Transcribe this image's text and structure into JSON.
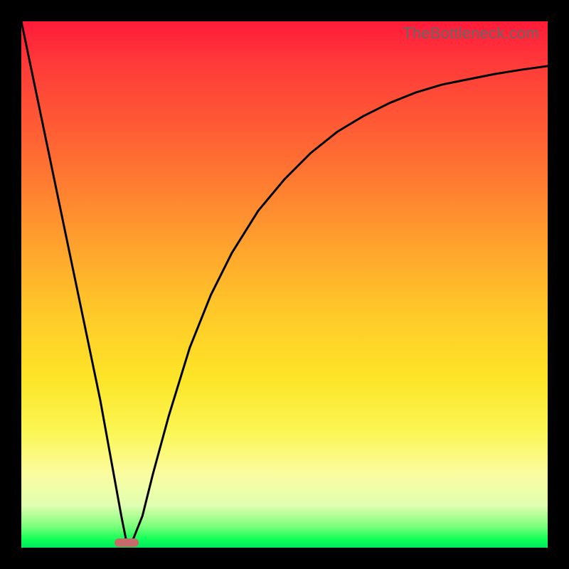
{
  "watermark": "TheBottleneck.com",
  "chart_data": {
    "type": "line",
    "title": "",
    "xlabel": "",
    "ylabel": "",
    "xlim": [
      0,
      100
    ],
    "ylim": [
      0,
      100
    ],
    "grid": false,
    "legend": false,
    "series": [
      {
        "name": "curve",
        "x": [
          0,
          5,
          10,
          15,
          19,
          20,
          21,
          23,
          25,
          28,
          32,
          36,
          40,
          45,
          50,
          55,
          60,
          65,
          70,
          75,
          80,
          85,
          90,
          95,
          100
        ],
        "y": [
          100,
          76,
          52,
          28,
          6,
          1,
          1,
          6,
          14,
          25,
          38,
          48,
          56,
          64,
          70,
          75,
          79,
          82,
          84.5,
          86.5,
          88,
          89,
          90,
          90.8,
          91.5
        ]
      }
    ],
    "marker": {
      "x": 20,
      "y": 1
    },
    "background_gradient": {
      "top": "#ff1a3a",
      "mid_upper": "#ff9a2e",
      "mid": "#fde528",
      "mid_lower": "#fbfca0",
      "bottom": "#00e860"
    }
  }
}
